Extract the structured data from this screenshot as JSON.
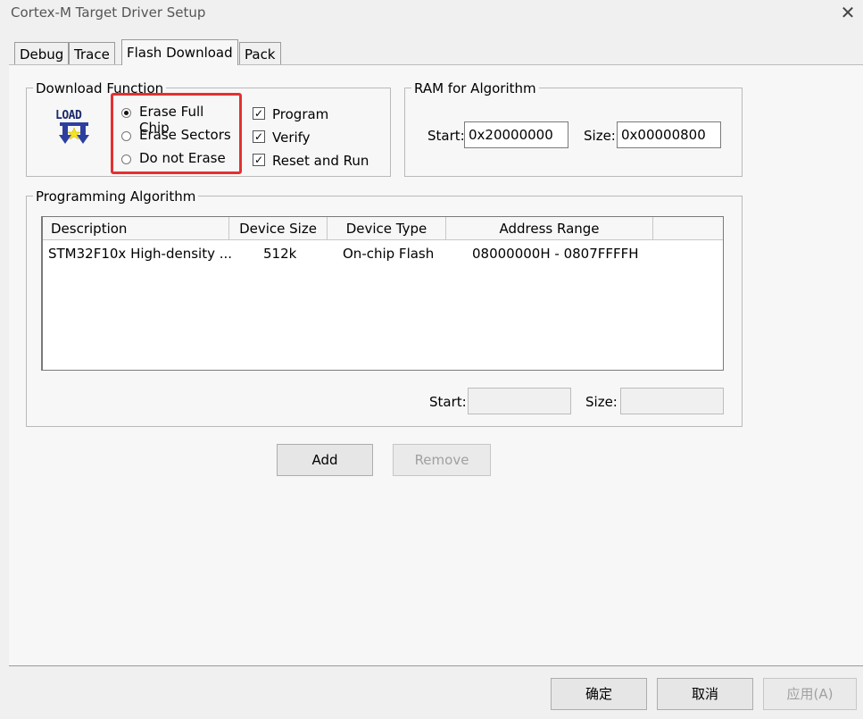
{
  "window": {
    "title": "Cortex-M Target Driver Setup"
  },
  "tabs": [
    {
      "label": "Debug"
    },
    {
      "label": "Trace"
    },
    {
      "label": "Flash Download"
    },
    {
      "label": "Pack"
    }
  ],
  "download_function": {
    "legend": "Download Function",
    "logo_text": "LOAD",
    "erase_options": [
      {
        "label": "Erase Full Chip",
        "selected": true
      },
      {
        "label": "Erase Sectors",
        "selected": false
      },
      {
        "label": "Do not Erase",
        "selected": false
      }
    ],
    "checkboxes": [
      {
        "label": "Program",
        "checked": true
      },
      {
        "label": "Verify",
        "checked": true
      },
      {
        "label": "Reset and Run",
        "checked": true
      }
    ]
  },
  "ram": {
    "legend": "RAM for Algorithm",
    "start_label": "Start:",
    "start_value": "0x20000000",
    "size_label": "Size:",
    "size_value": "0x00000800"
  },
  "programming_algorithm": {
    "legend": "Programming Algorithm",
    "columns": [
      "Description",
      "Device Size",
      "Device Type",
      "Address Range"
    ],
    "rows": [
      {
        "description": "STM32F10x High-density ...",
        "size": "512k",
        "type": "On-chip Flash",
        "range": "08000000H - 0807FFFFH"
      }
    ],
    "start_label": "Start:",
    "start_value": "",
    "size_label": "Size:",
    "size_value": ""
  },
  "actions": {
    "add": "Add",
    "remove": "Remove"
  },
  "footer": {
    "ok": "确定",
    "cancel": "取消",
    "apply": "应用(A)"
  },
  "colors": {
    "highlight": "#e53030"
  }
}
